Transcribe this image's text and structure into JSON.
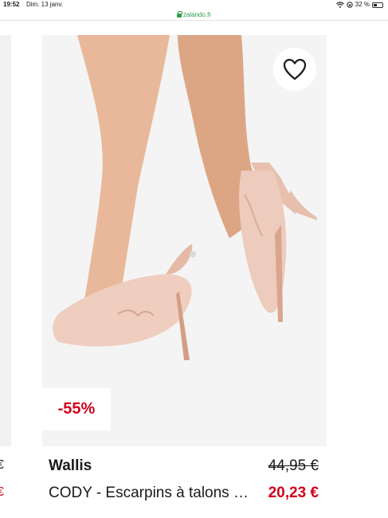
{
  "status_bar": {
    "time": "19:52",
    "date": "Dim. 13 janv.",
    "battery": "32 %",
    "battery_level": 0.32
  },
  "browser": {
    "url": "zalando.fr"
  },
  "left_product": {
    "partial_top": "€",
    "partial_bottom": "€"
  },
  "product": {
    "discount": "-55%",
    "brand": "Wallis",
    "name": "CODY - Escarpins à talons hauts - nude",
    "old_price": "44,95 €",
    "new_price": "20,23 €",
    "image_color": "#f2d3c8",
    "price_color": "#d0021b"
  },
  "icons": {
    "wishlist": "heart-icon",
    "secure": "lock-icon",
    "wifi": "wifi-icon",
    "battery": "battery-icon"
  }
}
